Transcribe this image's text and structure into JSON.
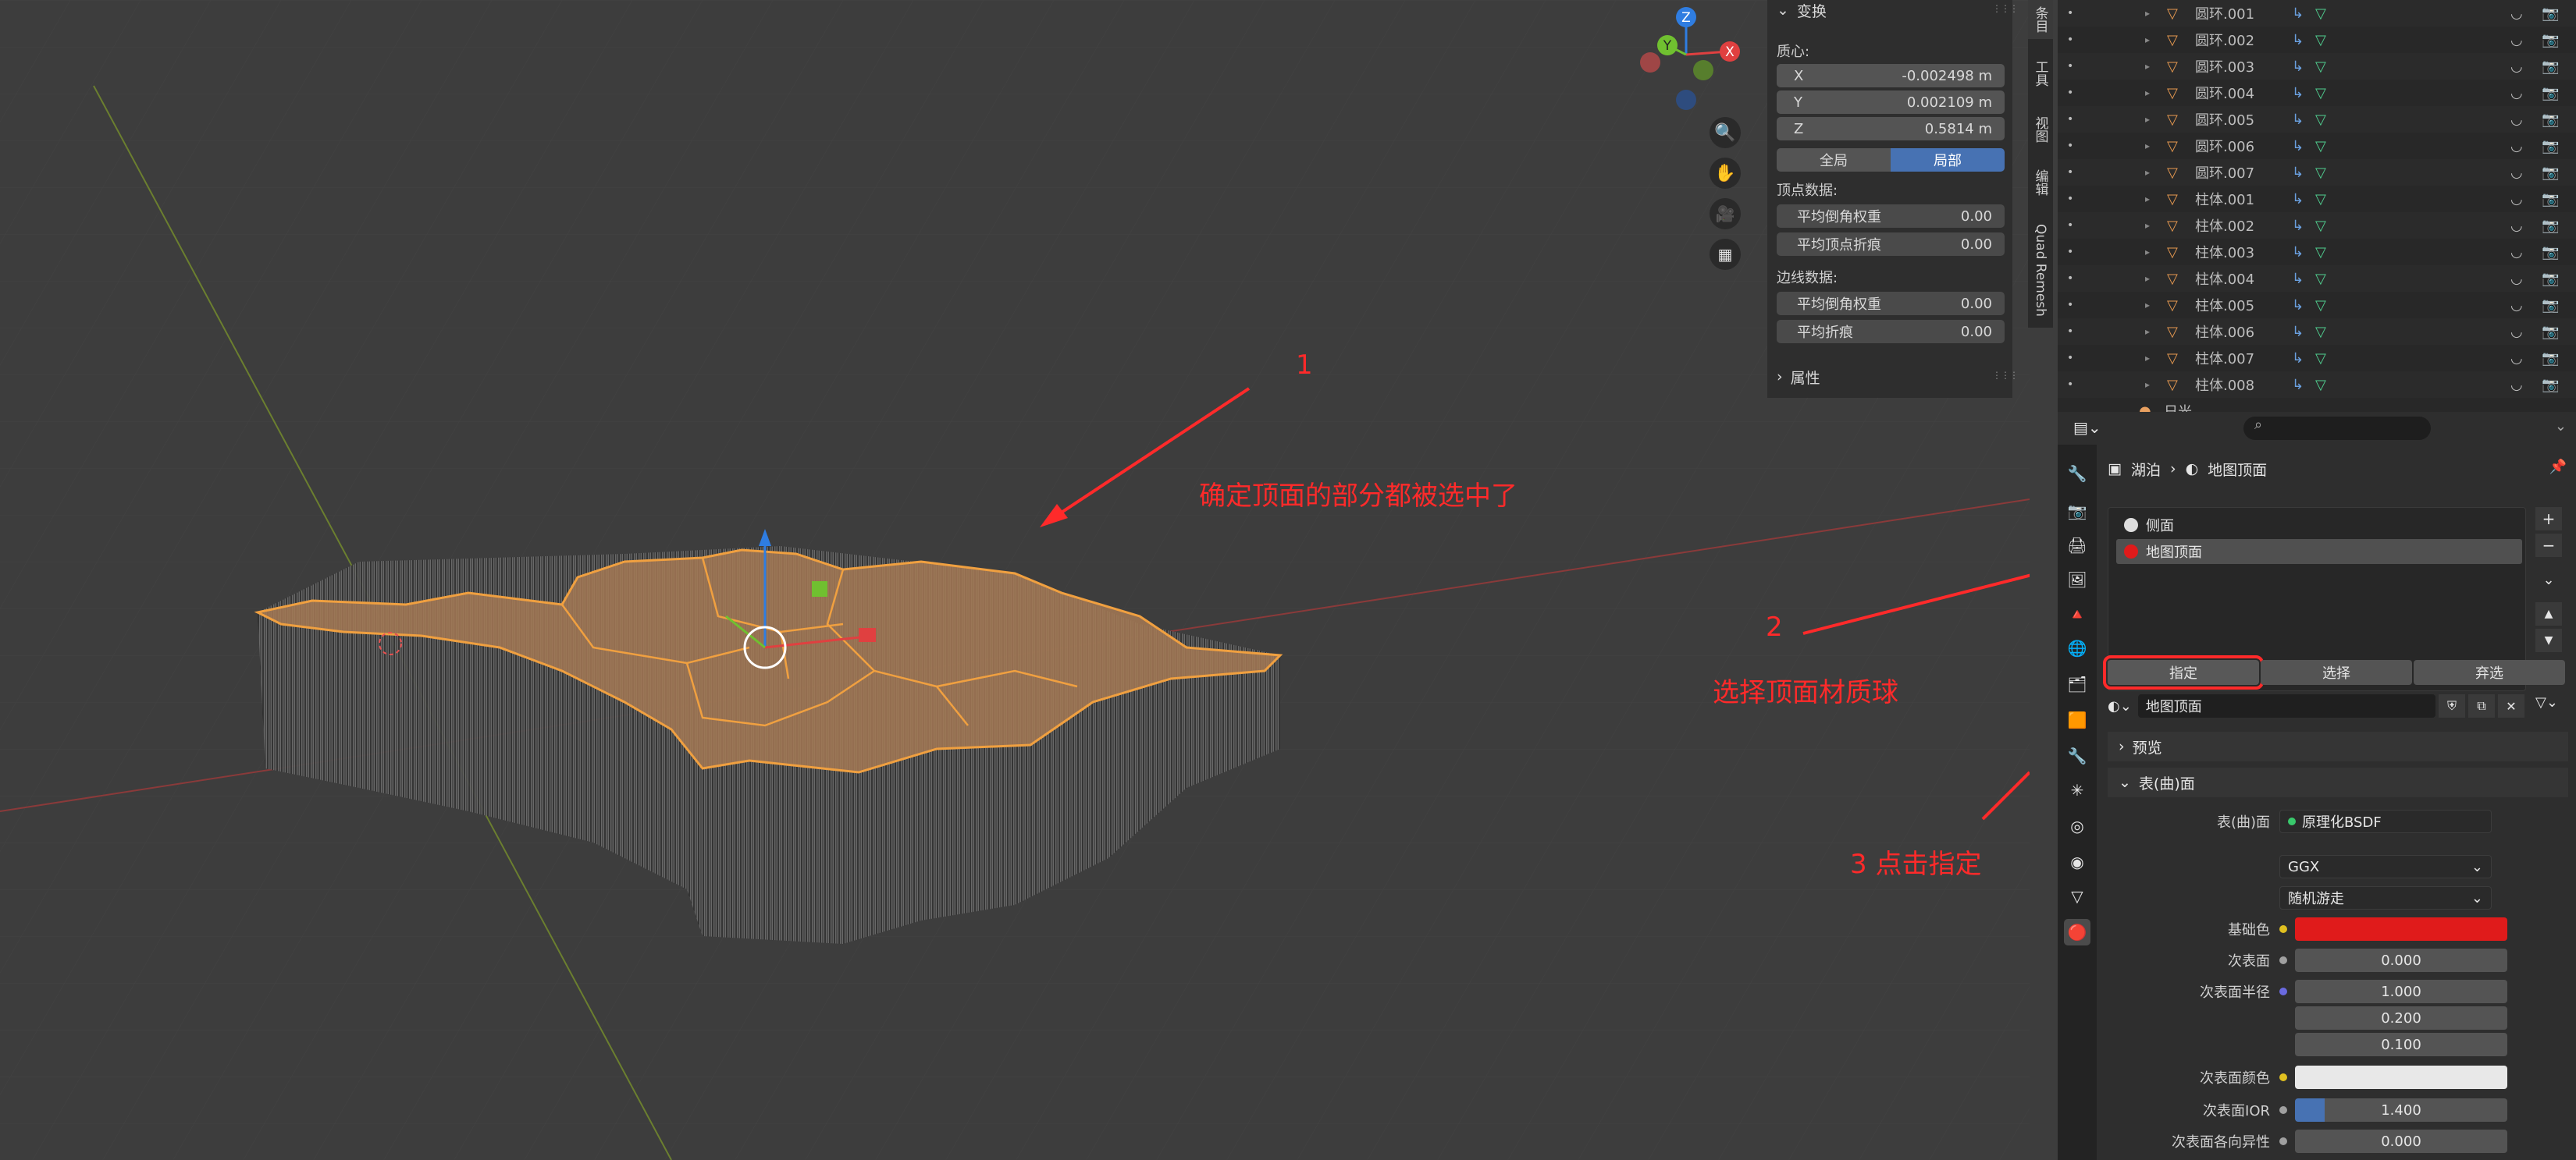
{
  "annotations": {
    "step1_num": "1",
    "step1_text": "确定顶面的部分都被选中了",
    "step2_num": "2",
    "step2_text": "选择顶面材质球",
    "step3_text": "3 点击指定",
    "color": "#ff2a2a"
  },
  "gizmo": {
    "z": "Z",
    "y": "Y",
    "x": "X"
  },
  "npanel": {
    "transform_title": "变换",
    "median_label": "质心:",
    "x_label": "X",
    "x_value": "-0.002498 m",
    "y_label": "Y",
    "y_value": "0.002109 m",
    "z_label": "Z",
    "z_value": "0.5814 m",
    "global_label": "全局",
    "local_label": "局部",
    "vertex_data_label": "顶点数据:",
    "vertex_bevel_label": "平均倒角权重",
    "vertex_bevel_value": "0.00",
    "vertex_crease_label": "平均顶点折痕",
    "vertex_crease_value": "0.00",
    "edge_data_label": "边线数据:",
    "edge_bevel_label": "平均倒角权重",
    "edge_bevel_value": "0.00",
    "edge_crease_label": "平均折痕",
    "edge_crease_value": "0.00",
    "properties_title": "属性"
  },
  "side_tabs": [
    "条目",
    "工具",
    "视图",
    "编辑",
    "Quad Remesh"
  ],
  "outliner": {
    "items": [
      "圆环.001",
      "圆环.002",
      "圆环.003",
      "圆环.004",
      "圆环.005",
      "圆环.006",
      "圆环.007",
      "柱体.001",
      "柱体.002",
      "柱体.003",
      "柱体.004",
      "柱体.005",
      "柱体.006",
      "柱体.007",
      "柱体.008"
    ],
    "partial_item": "日光"
  },
  "properties": {
    "breadcrumb_object": "湖泊",
    "breadcrumb_material": "地图顶面",
    "slots": [
      "侧面",
      "地图顶面"
    ],
    "assign_label": "指定",
    "select_label": "选择",
    "deselect_label": "弃选",
    "material_name": "地图顶面",
    "preview_label": "预览",
    "surface_section": "表(曲)面",
    "surface_label": "表(曲)面",
    "surface_value": "原理化BSDF",
    "distribution_value": "GGX",
    "subsurface_method_value": "随机游走",
    "base_color_label": "基础色",
    "base_color": "#e01b1b",
    "subsurface_label": "次表面",
    "subsurface_value": "0.000",
    "subsurface_radius_label": "次表面半径",
    "radius_1": "1.000",
    "radius_2": "0.200",
    "radius_3": "0.100",
    "subsurface_color_label": "次表面颜色",
    "subsurface_color": "#e8e8e8",
    "subsurface_ior_label": "次表面IOR",
    "subsurface_ior_value": "1.400",
    "subsurface_aniso_label": "次表面各向异性",
    "subsurface_aniso_value": "0.000"
  }
}
